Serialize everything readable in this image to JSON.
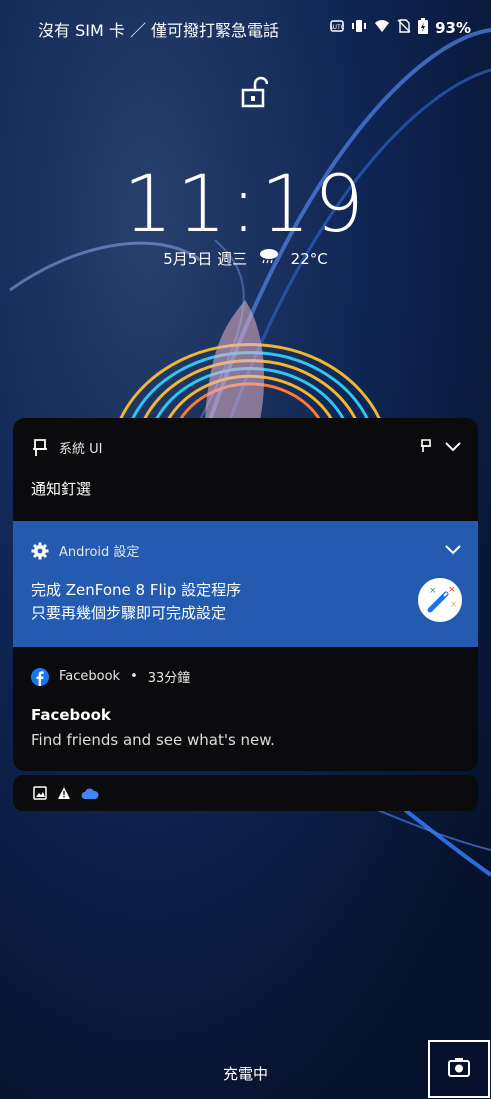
{
  "status_bar": {
    "carrier": "沒有 SIM 卡 ／ 僅可撥打緊急電話",
    "battery_percent": "93%"
  },
  "lockscreen": {
    "time": "11:19",
    "date": "5月5日 週三",
    "temperature": "22°C",
    "weather_icon": "cloud-rain-icon",
    "charging_text": "充電中"
  },
  "notifications": {
    "system": {
      "app_name": "系統 UI",
      "title": "通知釘選",
      "icon": "pin-icon"
    },
    "android_settings": {
      "app_name": "Android 設定",
      "title": "完成 ZenFone 8 Flip 設定程序",
      "text": "只要再幾個步驟即可完成設定",
      "icon": "gear-icon"
    },
    "facebook": {
      "app_name": "Facebook",
      "time": "33分鐘",
      "title": "Facebook",
      "text": "Find friends and see what's new.",
      "icon": "facebook-icon"
    }
  },
  "colors": {
    "android_card": "#245bb0",
    "facebook_blue": "#1877f2",
    "card_dark": "#0b0b0d"
  }
}
